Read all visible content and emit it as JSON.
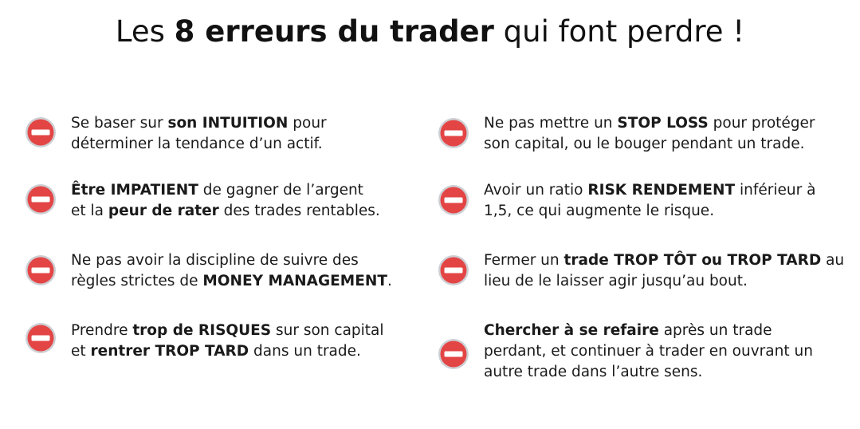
{
  "title": {
    "prefix": "Les ",
    "bold": "8 erreurs du trader",
    "suffix": " qui font perdre !"
  },
  "icon_name": "no-entry-icon",
  "colors": {
    "icon_red": "#e34545",
    "icon_border": "#cdd0d4",
    "text": "#1a1a1a"
  },
  "items": [
    {
      "lines": [
        [
          {
            "t": "Se baser sur "
          },
          {
            "t": "son INTUITION",
            "b": true
          },
          {
            "t": " pour"
          }
        ],
        [
          {
            "t": "déterminer la tendance d’un actif."
          }
        ]
      ]
    },
    {
      "lines": [
        [
          {
            "t": "Être IMPATIENT",
            "b": true
          },
          {
            "t": " de gagner de l’argent"
          }
        ],
        [
          {
            "t": "et la "
          },
          {
            "t": "peur de rater",
            "b": true
          },
          {
            "t": " des trades rentables."
          }
        ]
      ]
    },
    {
      "lines": [
        [
          {
            "t": "Ne pas avoir la discipline de suivre des"
          }
        ],
        [
          {
            "t": "règles strictes de "
          },
          {
            "t": "MONEY MANAGEMENT",
            "b": true
          },
          {
            "t": "."
          }
        ]
      ]
    },
    {
      "lines": [
        [
          {
            "t": "Prendre "
          },
          {
            "t": "trop de RISQUES",
            "b": true
          },
          {
            "t": " sur son capital"
          }
        ],
        [
          {
            "t": "et "
          },
          {
            "t": "rentrer TROP TARD",
            "b": true
          },
          {
            "t": " dans un trade."
          }
        ]
      ]
    },
    {
      "lines": [
        [
          {
            "t": "Ne pas mettre un "
          },
          {
            "t": "STOP LOSS",
            "b": true
          },
          {
            "t": " pour protéger"
          }
        ],
        [
          {
            "t": "son capital, ou le bouger pendant un trade."
          }
        ]
      ]
    },
    {
      "lines": [
        [
          {
            "t": "Avoir un ratio "
          },
          {
            "t": "RISK RENDEMENT",
            "b": true
          },
          {
            "t": " inférieur à"
          }
        ],
        [
          {
            "t": "1,5, ce qui augmente le risque."
          }
        ]
      ]
    },
    {
      "lines": [
        [
          {
            "t": "Fermer un "
          },
          {
            "t": "trade TROP TÔT ou TROP TARD",
            "b": true
          },
          {
            "t": " au"
          }
        ],
        [
          {
            "t": "lieu de le laisser agir jusqu’au bout."
          }
        ]
      ]
    },
    {
      "lines": [
        [
          {
            "t": "Chercher à se refaire",
            "b": true
          },
          {
            "t": " après un trade"
          }
        ],
        [
          {
            "t": "perdant, et continuer à trader en ouvrant un"
          }
        ],
        [
          {
            "t": "autre trade dans l’autre sens."
          }
        ]
      ]
    }
  ]
}
